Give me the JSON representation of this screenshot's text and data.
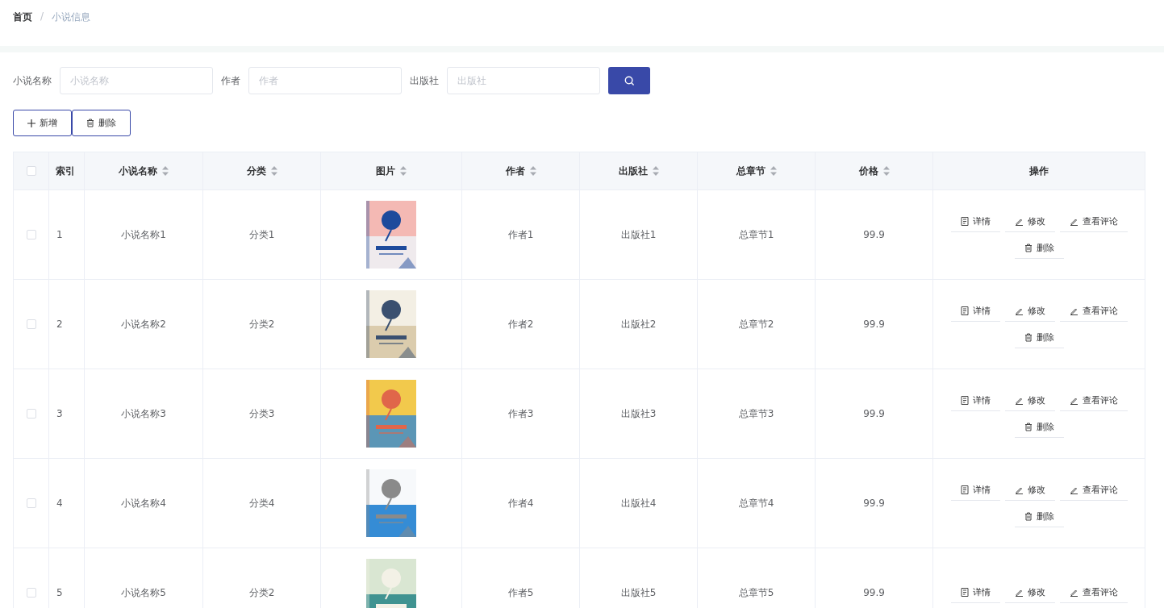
{
  "breadcrumb": {
    "separator": "/",
    "items": [
      {
        "label": "首页",
        "current": false
      },
      {
        "label": "小说信息",
        "current": true
      }
    ]
  },
  "search": {
    "fields": [
      {
        "label": "小说名称",
        "placeholder": "小说名称"
      },
      {
        "label": "作者",
        "placeholder": "作者"
      },
      {
        "label": "出版社",
        "placeholder": "出版社"
      }
    ]
  },
  "toolbar": [
    {
      "kind": "add",
      "label": "新增"
    },
    {
      "kind": "delete",
      "label": "删除"
    }
  ],
  "table": {
    "select_all": {
      "checked": false
    },
    "columns": [
      {
        "label": "索引",
        "sortable": false
      },
      {
        "label": "小说名称",
        "sortable": true
      },
      {
        "label": "分类",
        "sortable": true
      },
      {
        "label": "图片",
        "sortable": true
      },
      {
        "label": "作者",
        "sortable": true
      },
      {
        "label": "出版社",
        "sortable": true
      },
      {
        "label": "总章节",
        "sortable": true
      },
      {
        "label": "价格",
        "sortable": true
      },
      {
        "label": "操作",
        "sortable": false
      }
    ],
    "rows": [
      {
        "selected": false,
        "index": "1",
        "name": "小说名称1",
        "category": "分类1",
        "author": "作者1",
        "publisher": "出版社1",
        "chapters": "总章节1",
        "price": "99.9",
        "actions": [
          {
            "kind": "detail",
            "label": "详情"
          },
          {
            "kind": "edit",
            "label": "修改"
          },
          {
            "kind": "comments",
            "label": "查看评论"
          },
          {
            "kind": "delete",
            "label": "删除"
          }
        ]
      },
      {
        "selected": false,
        "index": "2",
        "name": "小说名称2",
        "category": "分类2",
        "author": "作者2",
        "publisher": "出版社2",
        "chapters": "总章节2",
        "price": "99.9",
        "actions": [
          {
            "kind": "detail",
            "label": "详情"
          },
          {
            "kind": "edit",
            "label": "修改"
          },
          {
            "kind": "comments",
            "label": "查看评论"
          },
          {
            "kind": "delete",
            "label": "删除"
          }
        ]
      },
      {
        "selected": false,
        "index": "3",
        "name": "小说名称3",
        "category": "分类3",
        "author": "作者3",
        "publisher": "出版社3",
        "chapters": "总章节3",
        "price": "99.9",
        "actions": [
          {
            "kind": "detail",
            "label": "详情"
          },
          {
            "kind": "edit",
            "label": "修改"
          },
          {
            "kind": "comments",
            "label": "查看评论"
          },
          {
            "kind": "delete",
            "label": "删除"
          }
        ]
      },
      {
        "selected": false,
        "index": "4",
        "name": "小说名称4",
        "category": "分类4",
        "author": "作者4",
        "publisher": "出版社4",
        "chapters": "总章节4",
        "price": "99.9",
        "actions": [
          {
            "kind": "detail",
            "label": "详情"
          },
          {
            "kind": "edit",
            "label": "修改"
          },
          {
            "kind": "comments",
            "label": "查看评论"
          },
          {
            "kind": "delete",
            "label": "删除"
          }
        ]
      },
      {
        "selected": false,
        "index": "5",
        "name": "小说名称5",
        "category": "分类2",
        "author": "作者5",
        "publisher": "出版社5",
        "chapters": "总章节5",
        "price": "99.9",
        "actions": [
          {
            "kind": "detail",
            "label": "详情"
          },
          {
            "kind": "edit",
            "label": "修改"
          },
          {
            "kind": "comments",
            "label": "查看评论"
          }
        ]
      }
    ]
  }
}
